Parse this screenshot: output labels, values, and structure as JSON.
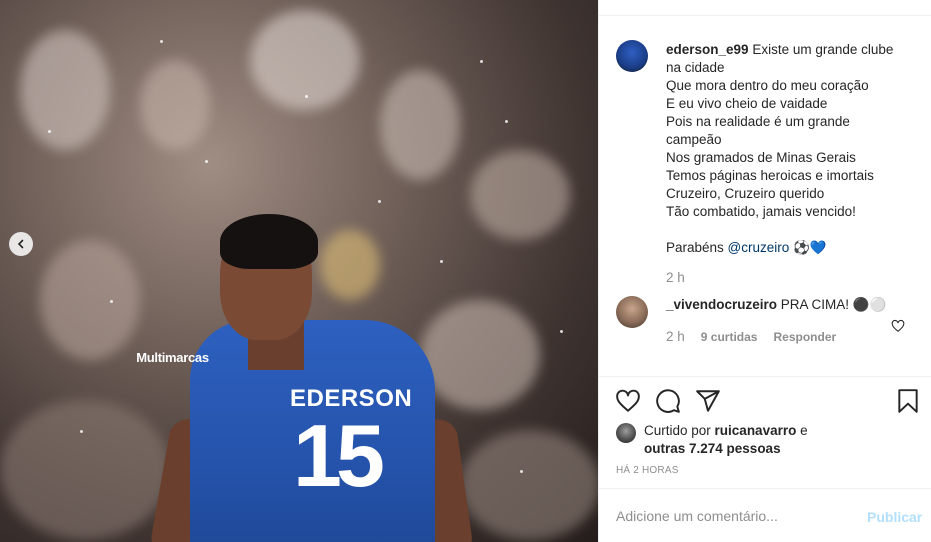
{
  "photo": {
    "jersey_sponsor": "Multimarcas",
    "jersey_name": "EDERSON",
    "jersey_number": "15",
    "prev_icon": "chevron-left-icon"
  },
  "caption": {
    "username": "ederson_e99",
    "lines": [
      "Existe um grande clube",
      "na cidade",
      "Que mora dentro do meu coração",
      "E eu vivo cheio de vaidade",
      "Pois na realidade é um grande",
      "campeão",
      "Nos gramados de Minas Gerais",
      "Temos páginas heroicas e imortais",
      "Cruzeiro, Cruzeiro querido",
      "Tão combatido, jamais vencido!"
    ],
    "signoff_prefix": "Parabéns ",
    "mention": "@cruzeiro",
    "signoff_emoji": " ⚽💙",
    "time": "2 h"
  },
  "comment": {
    "username": "_vivendocruzeiro",
    "text": " PRA CIMA! ⚫⚪",
    "time": "2 h",
    "likes": "9 curtidas",
    "reply_label": "Responder"
  },
  "actions": {
    "like_icon": "heart-icon",
    "comment_icon": "comment-icon",
    "share_icon": "share-icon",
    "save_icon": "bookmark-icon"
  },
  "likes": {
    "prefix": "Curtido por ",
    "user": "ruicanavarro",
    "middle": " e ",
    "others": "outras 7.274 pessoas"
  },
  "post_time": "HÁ 2 HORAS",
  "add_comment": {
    "placeholder": "Adicione um comentário...",
    "publish_label": "Publicar"
  }
}
